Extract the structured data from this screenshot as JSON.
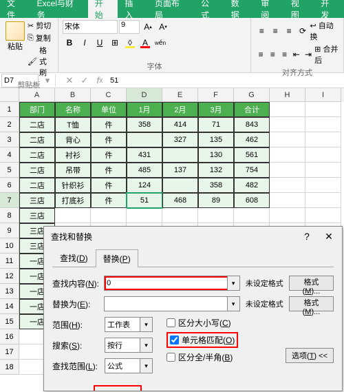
{
  "menu": [
    "文件",
    "Excel与财务",
    "开始",
    "插入",
    "页面布局",
    "公式",
    "数据",
    "审阅",
    "视图",
    "开发"
  ],
  "menu_active_idx": 2,
  "clipboard": {
    "cut": "剪切",
    "copy": "复制",
    "format": "格式刷",
    "paste": "粘贴",
    "group": "剪贴板"
  },
  "font": {
    "name": "宋体",
    "size": "9",
    "group": "字体"
  },
  "align": {
    "wrap": "自动换",
    "merge": "合并后",
    "group": "对齐方式"
  },
  "cellref": "D7",
  "formula": "51",
  "cols": [
    "A",
    "B",
    "C",
    "D",
    "E",
    "F",
    "G",
    "H",
    "I"
  ],
  "rows_count": 17,
  "hdr": [
    "部门",
    "名称",
    "单位",
    "1月",
    "2月",
    "3月",
    "合计"
  ],
  "data": [
    [
      "二店",
      "T恤",
      "件",
      "358",
      "414",
      "71",
      "843"
    ],
    [
      "二店",
      "背心",
      "件",
      "",
      "327",
      "135",
      "462"
    ],
    [
      "二店",
      "衬衫",
      "件",
      "431",
      "",
      "130",
      "561"
    ],
    [
      "二店",
      "吊带",
      "件",
      "485",
      "137",
      "132",
      "754"
    ],
    [
      "二店",
      "针织衫",
      "件",
      "124",
      "",
      "358",
      "482"
    ],
    [
      "三店",
      "打底衫",
      "件",
      "51",
      "468",
      "89",
      "608"
    ]
  ],
  "rest_rows": [
    "三店",
    "三店",
    "三店",
    "一店",
    "一店",
    "一店",
    "一店",
    "一店",
    "",
    "",
    ""
  ],
  "dialog": {
    "title": "查找和替换",
    "tab_find": "查找(D)",
    "tab_replace": "替换(P)",
    "find_label": "查找内容(N):",
    "replace_label": "替换为(E):",
    "find_val": "0",
    "replace_val": "",
    "no_format": "未设定格式",
    "format_btn": "格式(M)...",
    "scope_label": "范围(H):",
    "scope_val": "工作表",
    "search_label": "搜索(S):",
    "search_val": "按行",
    "lookin_label": "查找范围(L):",
    "lookin_val": "公式",
    "match_case": "区分大小写(C)",
    "match_cell": "单元格匹配(O)",
    "match_width": "区分全/半角(B)",
    "options": "选项(T) <<"
  }
}
